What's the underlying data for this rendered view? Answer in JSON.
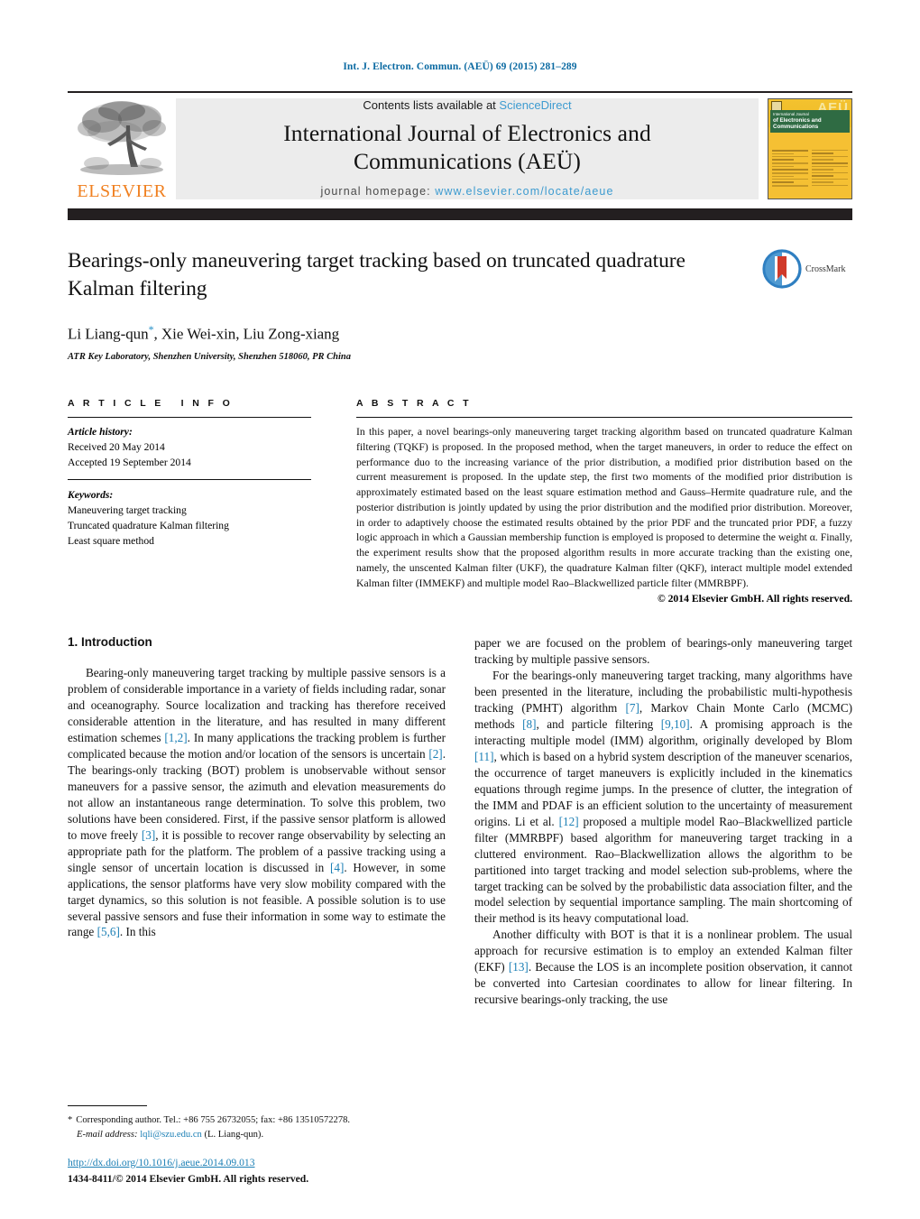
{
  "running_head": "Int. J. Electron. Commun. (AEÜ) 69 (2015) 281–289",
  "masthead": {
    "publisher_name": "ELSEVIER",
    "contents_prefix": "Contents lists available at ",
    "sciencedirect": "ScienceDirect",
    "journal_title_line1": "International Journal of Electronics and",
    "journal_title_line2": "Communications (AEÜ)",
    "homepage_label": "journal homepage:",
    "homepage_url": "www.elsevier.com/locate/aeue",
    "cover": {
      "aeu_mark": "AEÜ",
      "title_small": "International Journal",
      "title_line1": "of Electronics and",
      "title_line2": "Communications"
    }
  },
  "article": {
    "title": "Bearings-only maneuvering target tracking based on truncated quadrature Kalman filtering",
    "authors": "Li Liang-qun, Xie Wei-xin, Liu Zong-xiang",
    "corresponding_marker": "*",
    "affiliation": "ATR Key Laboratory, Shenzhen University, Shenzhen 518060, PR China",
    "crossmark_label": "CrossMark"
  },
  "article_info": {
    "heading": "ARTICLE INFO",
    "history_label": "Article history:",
    "received": "Received 20 May 2014",
    "accepted": "Accepted 19 September 2014",
    "keywords_label": "Keywords:",
    "keywords": [
      "Maneuvering target tracking",
      "Truncated quadrature Kalman filtering",
      "Least square method"
    ]
  },
  "abstract": {
    "heading": "ABSTRACT",
    "text": "In this paper, a novel bearings-only maneuvering target tracking algorithm based on truncated quadrature Kalman filtering (TQKF) is proposed. In the proposed method, when the target maneuvers, in order to reduce the effect on performance duo to the increasing variance of the prior distribution, a modified prior distribution based on the current measurement is proposed. In the update step, the first two moments of the modified prior distribution is approximately estimated based on the least square estimation method and Gauss–Hermite quadrature rule, and the posterior distribution is jointly updated by using the prior distribution and the modified prior distribution. Moreover, in order to adaptively choose the estimated results obtained by the prior PDF and the truncated prior PDF, a fuzzy logic approach in which a Gaussian membership function is employed is proposed to determine the weight α. Finally, the experiment results show that the proposed algorithm results in more accurate tracking than the existing one, namely, the unscented Kalman filter (UKF), the quadrature Kalman filter (QKF), interact multiple model extended Kalman filter (IMMEKF) and multiple model Rao–Blackwellized particle filter (MMRBPF).",
    "copyright": "© 2014 Elsevier GmbH. All rights reserved."
  },
  "introduction": {
    "section_number_title": "1.  Introduction",
    "left_paragraph_1_a": "Bearing-only maneuvering target tracking by multiple passive sensors is a problem of considerable importance in a variety of fields including radar, sonar and oceanography. Source localization and tracking has therefore received considerable attention in the literature, and has resulted in many different estimation schemes ",
    "cite_1_2": "[1,2]",
    "left_paragraph_1_b": ". In many applications the tracking problem is further complicated because the motion and/or location of the sensors is uncertain ",
    "cite_2": "[2]",
    "left_paragraph_1_c": ". The bearings-only tracking (BOT) problem is unobservable without sensor maneuvers for a passive sensor, the azimuth and elevation measurements do not allow an instantaneous range determination. To solve this problem, two solutions have been considered. First, if the passive sensor platform is allowed to move freely ",
    "cite_3": "[3]",
    "left_paragraph_1_d": ", it is possible to recover range observability by selecting an appropriate path for the platform. The problem of a passive tracking using a single sensor of uncertain location is discussed in ",
    "cite_4": "[4]",
    "left_paragraph_1_e": ". However, in some applications, the sensor platforms have very slow mobility compared with the target dynamics, so this solution is not feasible. A possible solution is to use several passive sensors and fuse their information in some way to estimate the range ",
    "cite_5_6": "[5,6]",
    "left_paragraph_1_f": ". In this ",
    "right_paragraph_1_cont": "paper we are focused on the problem of bearings-only maneuvering target tracking by multiple passive sensors.",
    "right_paragraph_2_a": "For the bearings-only maneuvering target tracking, many algorithms have been presented in the literature, including the probabilistic multi-hypothesis tracking (PMHT) algorithm ",
    "cite_7": "[7]",
    "right_paragraph_2_b": ", Markov Chain Monte Carlo (MCMC) methods ",
    "cite_8": "[8]",
    "right_paragraph_2_c": ", and particle filtering ",
    "cite_9_10": "[9,10]",
    "right_paragraph_2_d": ". A promising approach is the interacting multiple model (IMM) algorithm, originally developed by Blom ",
    "cite_11": "[11]",
    "right_paragraph_2_e": ", which is based on a hybrid system description of the maneuver scenarios, the occurrence of target maneuvers is explicitly included in the kinematics equations through regime jumps. In the presence of clutter, the integration of the IMM and PDAF is an efficient solution to the uncertainty of measurement origins. Li et al. ",
    "cite_12": "[12]",
    "right_paragraph_2_f": " proposed a multiple model Rao–Blackwellized particle filter (MMRBPF) based algorithm for maneuvering target tracking in a cluttered environment. Rao–Blackwellization allows the algorithm to be partitioned into target tracking and model selection sub-problems, where the target tracking can be solved by the probabilistic data association filter, and the model selection by sequential importance sampling. The main shortcoming of their method is its heavy computational load.",
    "right_paragraph_3_a": "Another difficulty with BOT is that it is a nonlinear problem. The usual approach for recursive estimation is to employ an extended Kalman filter (EKF) ",
    "cite_13": "[13]",
    "right_paragraph_3_b": ". Because the LOS is an incomplete position observation, it cannot be converted into Cartesian coordinates to allow for linear filtering. In recursive bearings-only tracking, the use"
  },
  "footer": {
    "corresponding_star": "*",
    "corresponding_text": "Corresponding author. Tel.: +86 755 26732055; fax: +86 13510572278.",
    "email_label": "E-mail address:",
    "email": "lqli@szu.edu.cn",
    "email_owner": "(L. Liang-qun).",
    "doi_url": "http://dx.doi.org/10.1016/j.aeue.2014.09.013",
    "issn_line": "1434-8411/© 2014 Elsevier GmbH. All rights reserved."
  },
  "colors": {
    "link_blue": "#1b7fb5",
    "header_blue": "#0b6aa2",
    "elsevier_orange": "#f08020",
    "masthead_grey": "#ececec",
    "bar_black": "#231f20"
  }
}
